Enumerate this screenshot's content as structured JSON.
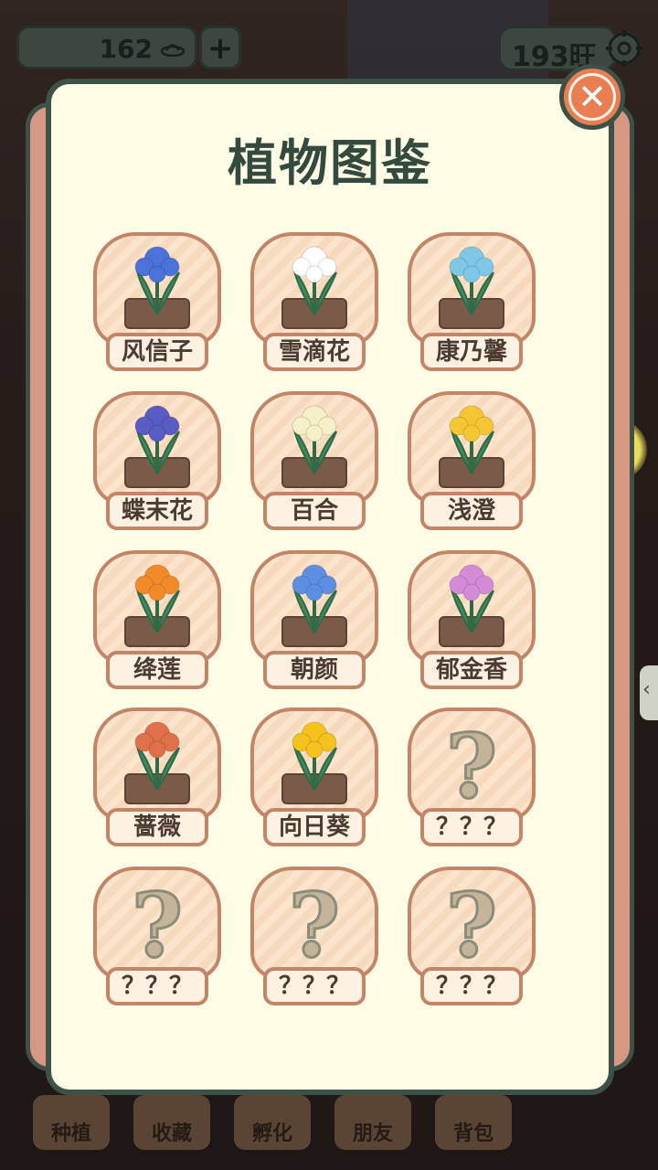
{
  "top_bar": {
    "coins": "162",
    "plus_label": "+",
    "score": "193旺"
  },
  "panel": {
    "title": "植物图鉴",
    "close_label": "✕"
  },
  "plants": [
    {
      "label": "风信子",
      "color": "#4a72d8",
      "unlocked": true
    },
    {
      "label": "雪滴花",
      "color": "#ffffff",
      "unlocked": true
    },
    {
      "label": "康乃馨",
      "color": "#7ec7e6",
      "unlocked": true
    },
    {
      "label": "蝶末花",
      "color": "#5a5cc4",
      "unlocked": true
    },
    {
      "label": "百合",
      "color": "#f5f0c8",
      "unlocked": true
    },
    {
      "label": "浅澄",
      "color": "#f6c632",
      "unlocked": true
    },
    {
      "label": "绛莲",
      "color": "#f28a2a",
      "unlocked": true
    },
    {
      "label": "朝颜",
      "color": "#5c8fe0",
      "unlocked": true
    },
    {
      "label": "郁金香",
      "color": "#d58ad8",
      "unlocked": true
    },
    {
      "label": "蔷薇",
      "color": "#e0704a",
      "unlocked": true
    },
    {
      "label": "向日葵",
      "color": "#f4c21c",
      "unlocked": true
    },
    {
      "label": "？？？",
      "color": "#c3b49a",
      "unlocked": false
    },
    {
      "label": "？？？",
      "color": "#c3b49a",
      "unlocked": false
    },
    {
      "label": "？？？",
      "color": "#c3b49a",
      "unlocked": false
    },
    {
      "label": "？？？",
      "color": "#c3b49a",
      "unlocked": false
    }
  ],
  "bottom_nav": [
    {
      "label": "种植"
    },
    {
      "label": "收藏"
    },
    {
      "label": "孵化"
    },
    {
      "label": "朋友"
    },
    {
      "label": "背包"
    }
  ]
}
